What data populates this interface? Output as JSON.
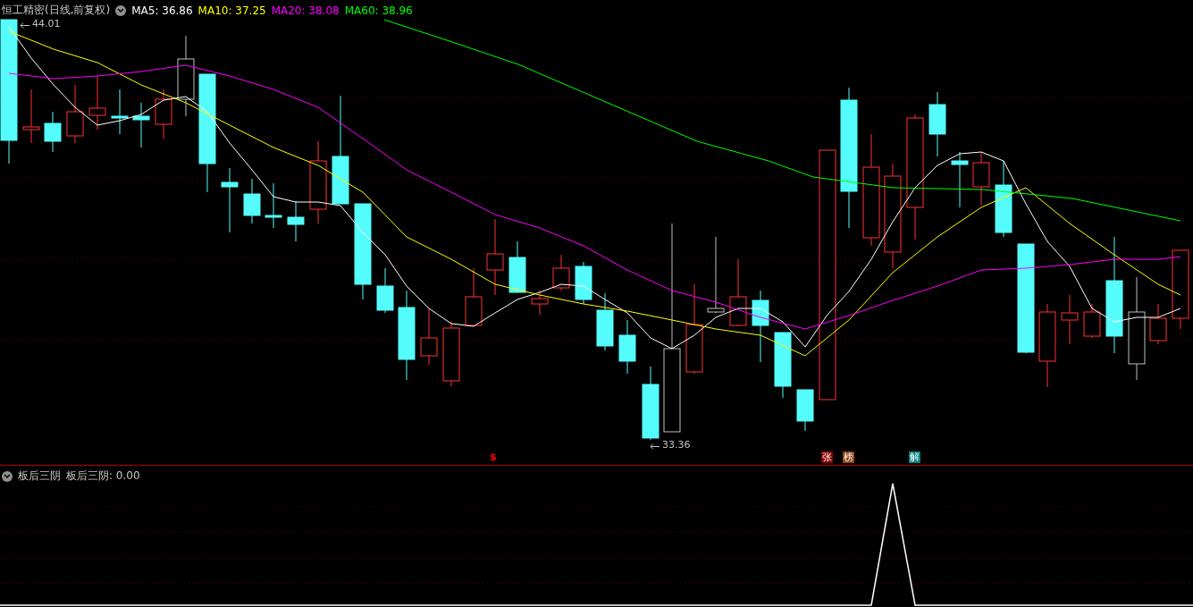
{
  "header": {
    "title": "恒工精密(日线,前复权)",
    "indicators": [
      {
        "label": "MA5: 36.86",
        "color": "#ffffff"
      },
      {
        "label": "MA10: 37.25",
        "color": "#ffff00"
      },
      {
        "label": "MA20: 38.08",
        "color": "#ff00ff"
      },
      {
        "label": "MA60: 38.96",
        "color": "#00ff00"
      }
    ]
  },
  "price_chart": {
    "high_label": "44.01",
    "low_label": "33.36",
    "markers": [
      {
        "text": "$",
        "kind": "arrow",
        "color": "#ff0000"
      },
      {
        "text": "张",
        "kind": "tag",
        "color": "#8b0000"
      },
      {
        "text": "榜",
        "kind": "tag",
        "color": "#8b4513"
      },
      {
        "text": "解",
        "kind": "tag",
        "color": "#008080"
      }
    ]
  },
  "indicator_panel": {
    "title": "板后三阴",
    "readout": "板后三阴: 0.00"
  }
}
